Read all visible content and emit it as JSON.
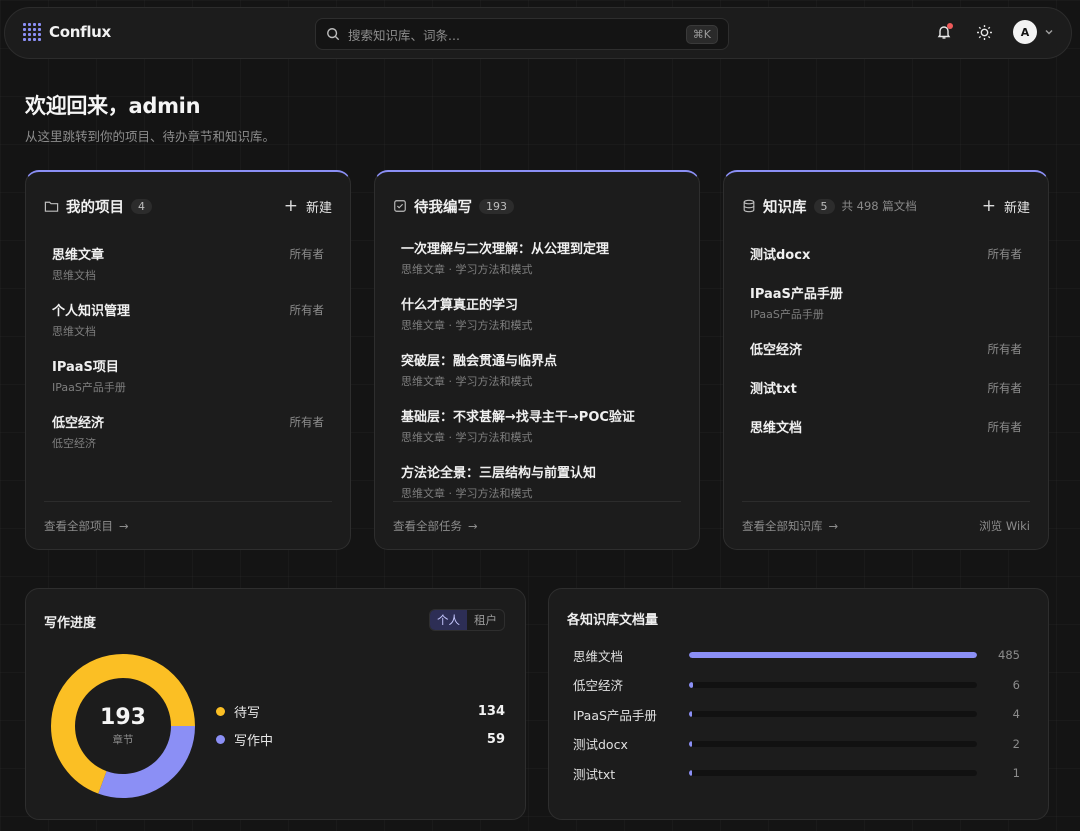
{
  "app": {
    "name": "Conflux"
  },
  "search": {
    "placeholder": "搜索知识库、词条...",
    "shortcut": "⌘K"
  },
  "user": {
    "initial": "A"
  },
  "welcome": {
    "title": "欢迎回来，admin",
    "subtitle": "从这里跳转到你的项目、待办章节和知识库。"
  },
  "projects": {
    "title": "我的项目",
    "count": "4",
    "new_label": "新建",
    "items": [
      {
        "title": "思维文章",
        "sub": "思维文档",
        "tag": "所有者"
      },
      {
        "title": "个人知识管理",
        "sub": "思维文档",
        "tag": "所有者"
      },
      {
        "title": "IPaaS项目",
        "sub": "IPaaS产品手册",
        "tag": ""
      },
      {
        "title": "低空经济",
        "sub": "低空经济",
        "tag": "所有者"
      }
    ],
    "footer_link": "查看全部项目"
  },
  "todo": {
    "title": "待我编写",
    "count": "193",
    "items": [
      {
        "title": "一次理解与二次理解：从公理到定理",
        "sub": "思维文章 · 学习方法和模式"
      },
      {
        "title": "什么才算真正的学习",
        "sub": "思维文章 · 学习方法和模式"
      },
      {
        "title": "突破层：融会贯通与临界点",
        "sub": "思维文章 · 学习方法和模式"
      },
      {
        "title": "基础层：不求甚解→找寻主干→POC验证",
        "sub": "思维文章 · 学习方法和模式"
      },
      {
        "title": "方法论全景：三层结构与前置认知",
        "sub": "思维文章 · 学习方法和模式"
      }
    ],
    "footer_link": "查看全部任务"
  },
  "kb": {
    "title": "知识库",
    "count": "5",
    "note": "共 498 篇文档",
    "new_label": "新建",
    "items": [
      {
        "title": "测试docx",
        "sub": "",
        "tag": "所有者"
      },
      {
        "title": "IPaaS产品手册",
        "sub": "IPaaS产品手册",
        "tag": ""
      },
      {
        "title": "低空经济",
        "sub": "",
        "tag": "所有者"
      },
      {
        "title": "测试txt",
        "sub": "",
        "tag": "所有者"
      },
      {
        "title": "思维文档",
        "sub": "",
        "tag": "所有者"
      }
    ],
    "footer_link": "查看全部知识库",
    "footer_right": "浏览 Wiki"
  },
  "progress": {
    "title": "写作进度",
    "toggle": [
      "个人",
      "租户"
    ],
    "total": "193",
    "total_label": "章节"
  },
  "docs_chart": {
    "title": "各知识库文档量"
  },
  "colors": {
    "accent": "#8b8ff5",
    "pending": "#fbbf24",
    "writing": "#8b8ff5"
  },
  "chart_data": [
    {
      "type": "pie",
      "categories": [
        "待写",
        "写作中"
      ],
      "values": [
        134,
        59
      ],
      "colors": [
        "#fbbf24",
        "#8b8ff5"
      ]
    },
    {
      "type": "bar",
      "orientation": "horizontal",
      "categories": [
        "思维文档",
        "低空经济",
        "IPaaS产品手册",
        "测试docx",
        "测试txt"
      ],
      "values": [
        485,
        6,
        4,
        2,
        1
      ]
    }
  ]
}
